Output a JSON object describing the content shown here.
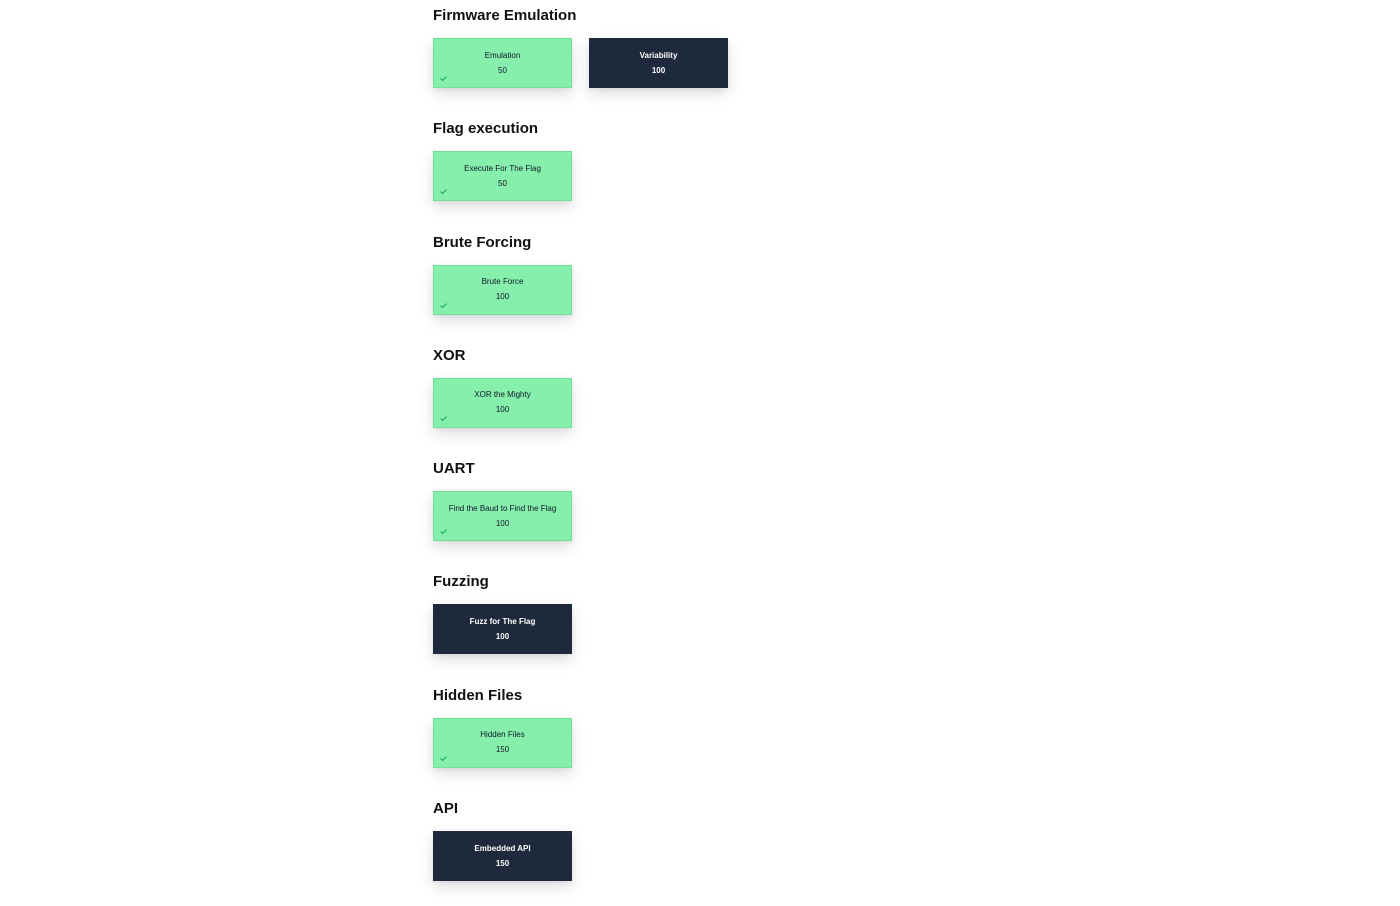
{
  "colors": {
    "solved_bg": "#86efac",
    "unsolved_bg": "#1e293b",
    "check": "#16a34a"
  },
  "categories": [
    {
      "title": "Firmware Emulation",
      "challenges": [
        {
          "name": "Emulation",
          "value": "50",
          "solved": true,
          "icon": "check-icon"
        },
        {
          "name": "Variability",
          "value": "100",
          "solved": false
        }
      ]
    },
    {
      "title": "Flag execution",
      "challenges": [
        {
          "name": "Execute For The Flag",
          "value": "50",
          "solved": true,
          "icon": "check-icon"
        }
      ]
    },
    {
      "title": "Brute Forcing",
      "challenges": [
        {
          "name": "Brute Force",
          "value": "100",
          "solved": true,
          "icon": "check-icon"
        }
      ]
    },
    {
      "title": "XOR",
      "challenges": [
        {
          "name": "XOR the Mighty",
          "value": "100",
          "solved": true,
          "icon": "check-icon"
        }
      ]
    },
    {
      "title": "UART",
      "challenges": [
        {
          "name": "Find the Baud to Find the Flag",
          "value": "100",
          "solved": true,
          "icon": "check-icon"
        }
      ]
    },
    {
      "title": "Fuzzing",
      "challenges": [
        {
          "name": "Fuzz for The Flag",
          "value": "100",
          "solved": false
        }
      ]
    },
    {
      "title": "Hidden Files",
      "challenges": [
        {
          "name": "Hidden Files",
          "value": "150",
          "solved": true,
          "icon": "check-icon"
        }
      ]
    },
    {
      "title": "API",
      "challenges": [
        {
          "name": "Embedded API",
          "value": "150",
          "solved": false
        }
      ]
    }
  ]
}
